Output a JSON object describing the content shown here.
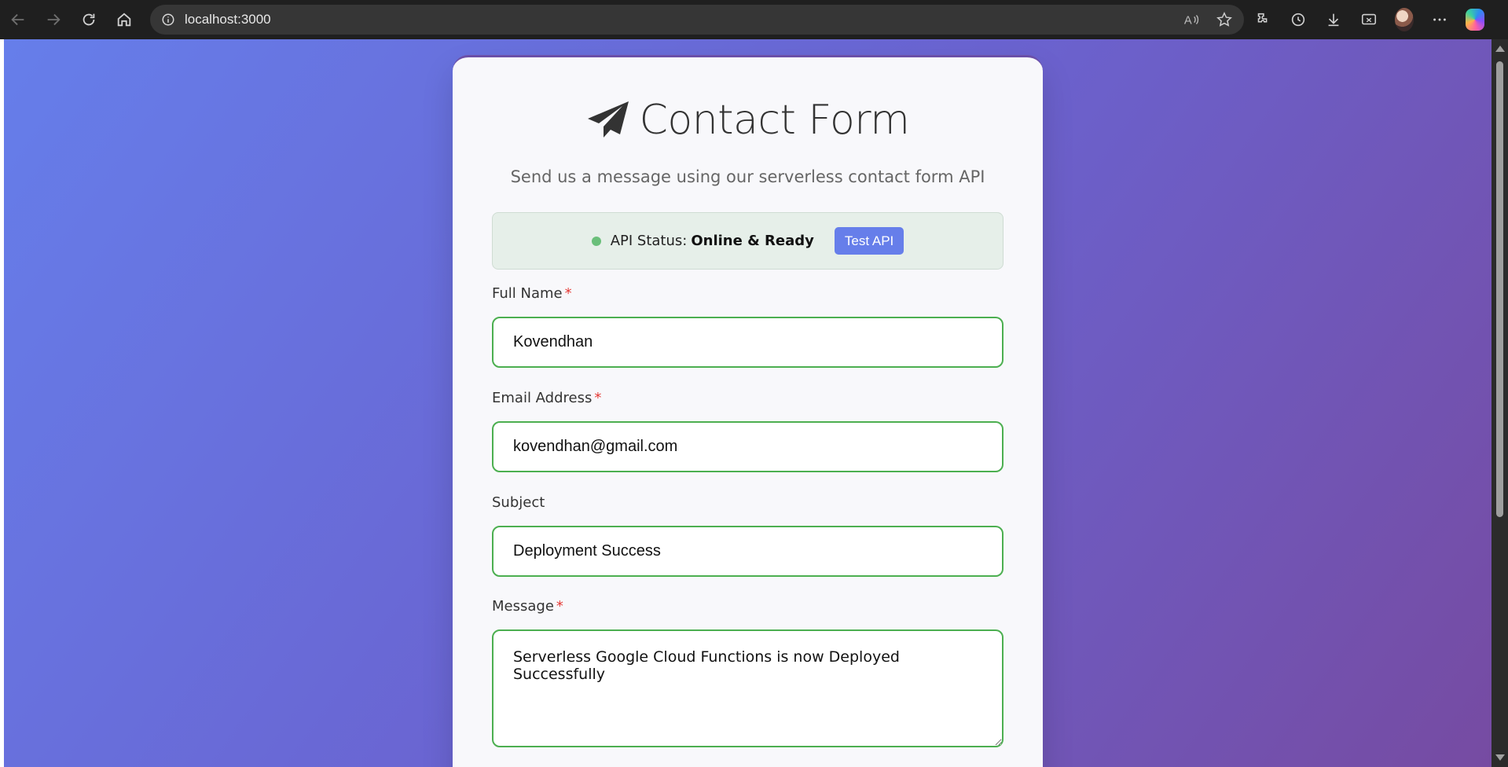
{
  "browser": {
    "url": "localhost:3000"
  },
  "card": {
    "title": "Contact Form",
    "subtitle": "Send us a message using our serverless contact form API",
    "status": {
      "label": "API Status:",
      "value": "Online & Ready",
      "button": "Test API",
      "dot_color": "#6abf7a"
    },
    "fields": {
      "name": {
        "label": "Full Name",
        "required": "*",
        "value": "Kovendhan"
      },
      "email": {
        "label": "Email Address",
        "required": "*",
        "value": "kovendhan@gmail.com"
      },
      "subject": {
        "label": "Subject",
        "value": "Deployment Success"
      },
      "message": {
        "label": "Message",
        "required": "*",
        "value": "Serverless Google Cloud Functions is now Deployed Successfully"
      }
    }
  },
  "colors": {
    "accent": "#667eea",
    "valid_border": "#4caf50",
    "required": "#e53935",
    "gradient_start": "#667eea",
    "gradient_end": "#764ba2"
  }
}
